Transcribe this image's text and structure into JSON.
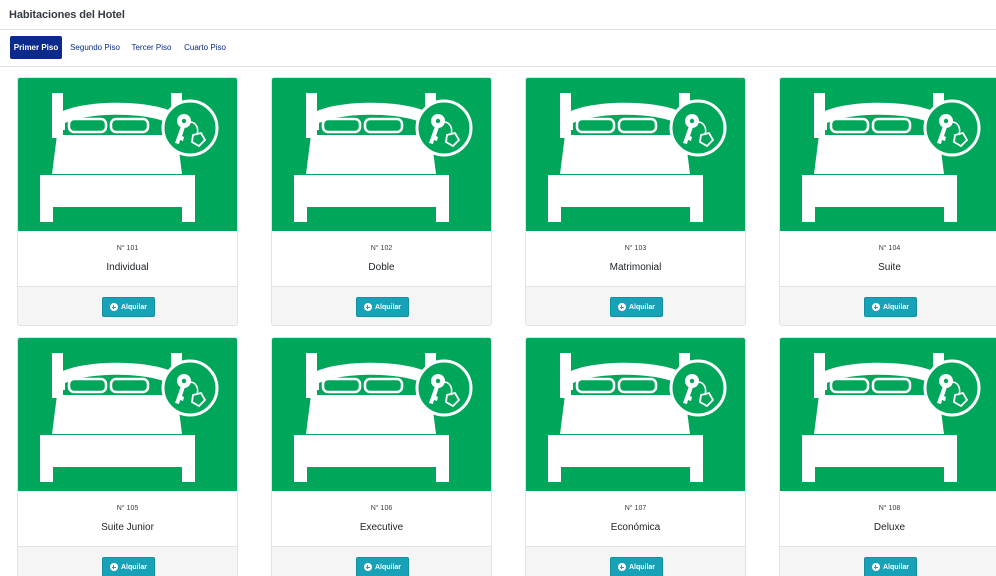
{
  "header": {
    "title": "Habitaciones del Hotel"
  },
  "tabs": [
    {
      "label": "Primer Piso",
      "active": true
    },
    {
      "label": "Segundo Piso",
      "active": false
    },
    {
      "label": "Tercer Piso",
      "active": false
    },
    {
      "label": "Cuarto Piso",
      "active": false
    }
  ],
  "rooms": [
    {
      "number": "N° 101",
      "type": "Individual",
      "button": "Alquilar"
    },
    {
      "number": "N° 102",
      "type": "Doble",
      "button": "Alquilar"
    },
    {
      "number": "N° 103",
      "type": "Matrimonial",
      "button": "Alquilar"
    },
    {
      "number": "N° 104",
      "type": "Suite",
      "button": "Alquilar"
    },
    {
      "number": "N° 105",
      "type": "Suite Junior",
      "button": "Alquilar"
    },
    {
      "number": "N° 106",
      "type": "Executive",
      "button": "Alquilar"
    },
    {
      "number": "N° 107",
      "type": "Económica",
      "button": "Alquilar"
    },
    {
      "number": "N° 108",
      "type": "Deluxe",
      "button": "Alquilar"
    }
  ],
  "icons": {
    "room_image": "bed-with-key-icon",
    "rent_button": "plus-circle-icon"
  },
  "colors": {
    "room_available": "#00a65a",
    "tab_active": "#0b2a8c",
    "button": "#17a2b8"
  }
}
